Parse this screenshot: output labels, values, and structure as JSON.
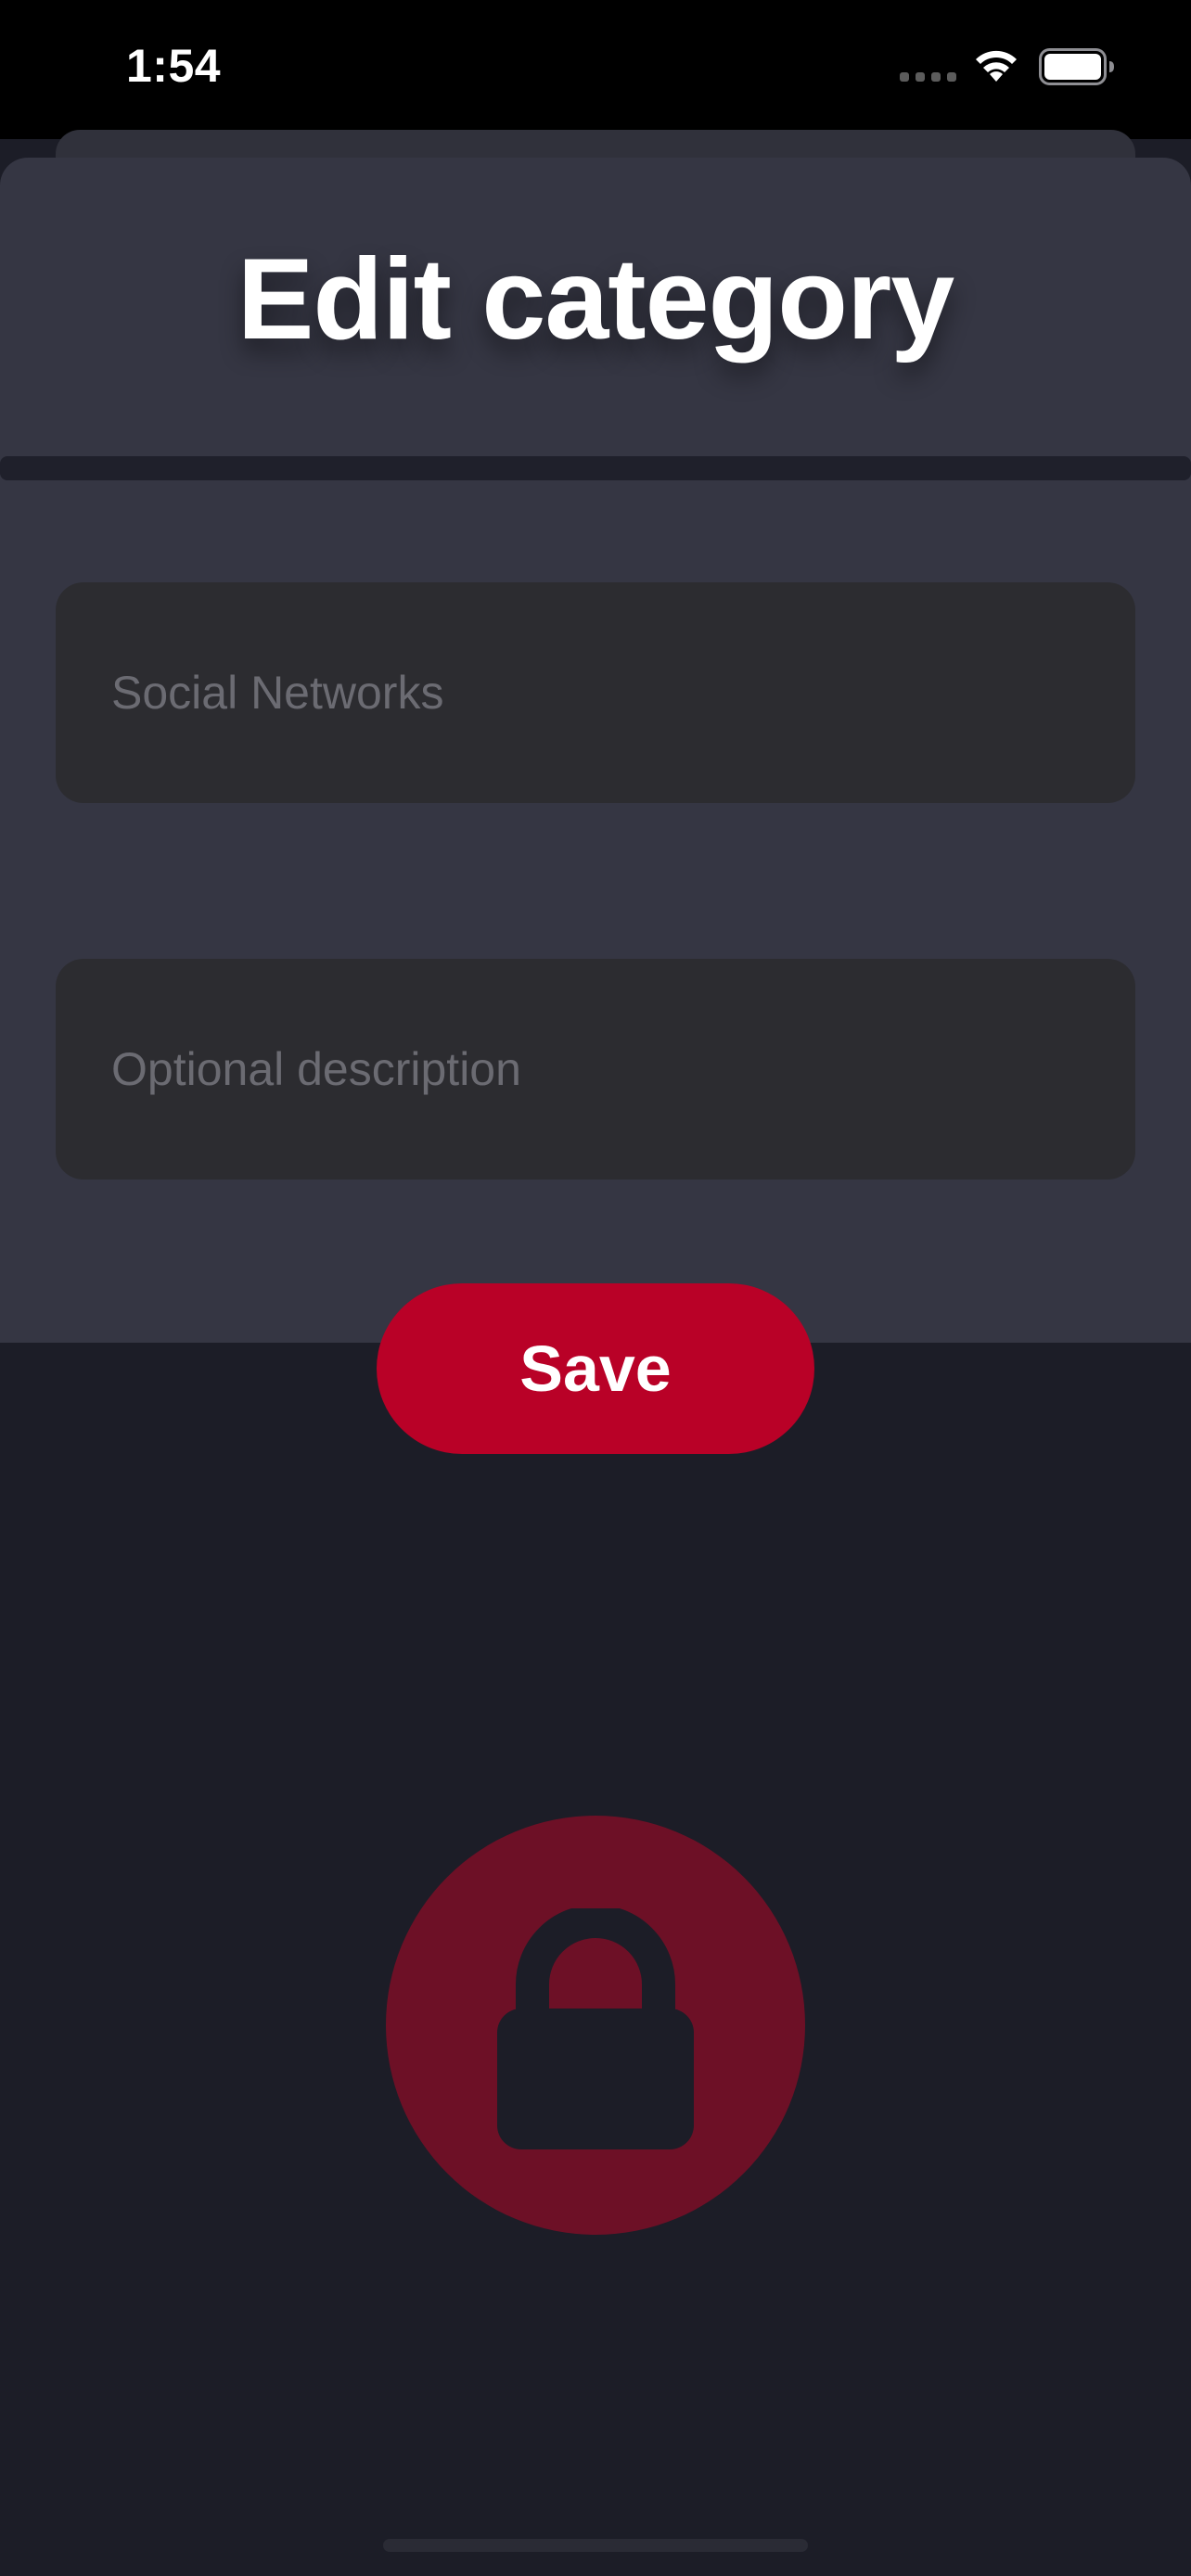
{
  "status_bar": {
    "time": "1:54"
  },
  "sheet": {
    "title": "Edit category"
  },
  "form": {
    "name_placeholder": "Social Networks",
    "name_value": "",
    "description_placeholder": "Optional description",
    "description_value": ""
  },
  "actions": {
    "save_label": "Save"
  },
  "icons": {
    "status": [
      "cellular-icon",
      "wifi-icon",
      "battery-icon"
    ],
    "center": "lock-icon"
  },
  "colors": {
    "background": "#1c1d27",
    "sheet": "#353643",
    "field": "#2c2c30",
    "accent": "#b90127",
    "lock_circle": "#6d1026"
  }
}
